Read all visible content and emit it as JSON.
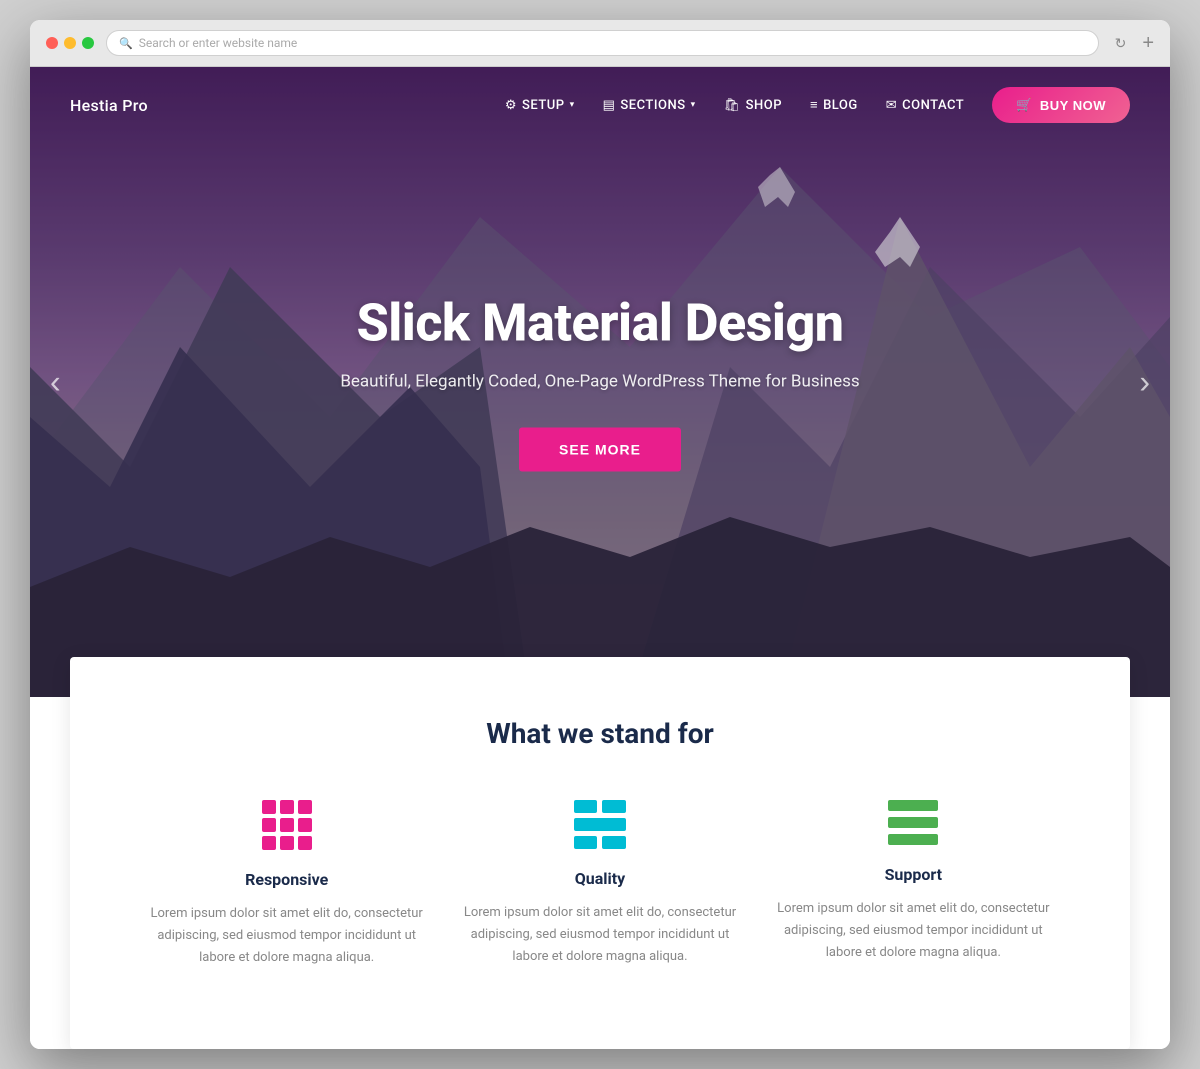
{
  "browser": {
    "address_placeholder": "Search or enter website name"
  },
  "navbar": {
    "brand": "Hestia Pro",
    "items": [
      {
        "id": "setup",
        "icon": "⚙",
        "label": "SETUP",
        "has_arrow": true
      },
      {
        "id": "sections",
        "icon": "☰",
        "label": "SECTIONS",
        "has_arrow": true
      },
      {
        "id": "shop",
        "icon": "🛍",
        "label": "SHOP",
        "has_arrow": false
      },
      {
        "id": "blog",
        "icon": "☰",
        "label": "BLOG",
        "has_arrow": false
      },
      {
        "id": "contact",
        "icon": "✉",
        "label": "CONTACT",
        "has_arrow": false
      }
    ],
    "buy_label": "BUY NOW",
    "cart_icon": "🛒"
  },
  "hero": {
    "title": "Slick Material Design",
    "subtitle": "Beautiful, Elegantly Coded, One-Page WordPress Theme for Business",
    "cta_label": "SEE MORE"
  },
  "features": {
    "section_title": "What we stand for",
    "items": [
      {
        "id": "responsive",
        "title": "Responsive",
        "description": "Lorem ipsum dolor sit amet elit do, consectetur adipiscing, sed eiusmod tempor incididunt ut labore et dolore magna aliqua."
      },
      {
        "id": "quality",
        "title": "Quality",
        "description": "Lorem ipsum dolor sit amet elit do, consectetur adipiscing, sed eiusmod tempor incididunt ut labore et dolore magna aliqua."
      },
      {
        "id": "support",
        "title": "Support",
        "description": "Lorem ipsum dolor sit amet elit do, consectetur adipiscing, sed eiusmod tempor incididunt ut labore et dolore magna aliqua."
      }
    ]
  }
}
